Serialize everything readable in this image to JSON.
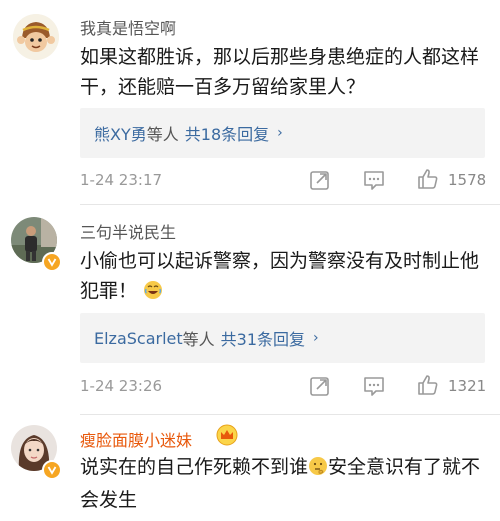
{
  "comments": [
    {
      "username": "我真是悟空啊",
      "text": "如果这都胜诉，那以后那些身患绝症的人都这样干，还能赔一百多万留给家里人？",
      "reply": {
        "users": "熊XY勇",
        "suffix": "等人",
        "count_label": "共18条回复",
        "arrow": "›"
      },
      "time": "1-24 23:17",
      "likes": "1578",
      "avatar_icon": "monkey-avatar"
    },
    {
      "username": "三句半说民生",
      "text": "小偷也可以起诉警察，因为警察没有及时制止他犯罪！",
      "reply": {
        "users": "ElzaScarlet",
        "suffix": "等人",
        "count_label": "共31条回复",
        "arrow": "›"
      },
      "time": "1-24 23:26",
      "likes": "1321",
      "avatar_icon": "person-photo-avatar",
      "verified_badge": "yellow-v-badge"
    },
    {
      "username": "瘦脸面膜小迷妹",
      "text_part1": "说实在的自己作死赖不到谁",
      "text_part2": "安全意识有了就不会发生",
      "avatar_icon": "girl-photo-avatar",
      "crown_badge": "crown-icon",
      "verified_badge": "yellow-v-badge"
    }
  ],
  "icons": {
    "share": "share-icon",
    "comment": "comment-icon",
    "like": "thumbs-up-icon"
  },
  "colors": {
    "link_blue": "#3b6aa0",
    "vip_orange": "#e8590c",
    "reply_bg": "#f3f3f3"
  }
}
